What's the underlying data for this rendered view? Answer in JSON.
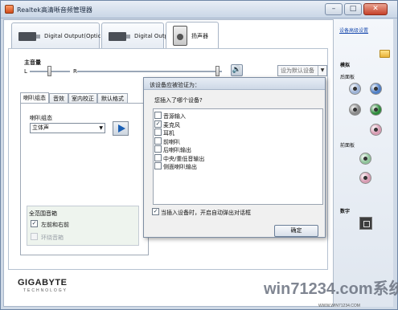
{
  "window": {
    "title": "Realtek高清晰音频管理器",
    "minimize": "–",
    "maximize": "□",
    "close": "✕"
  },
  "device_tabs": [
    {
      "label": "Digital Output(Optical)"
    },
    {
      "label": "Digital Output"
    },
    {
      "label": "扬声器",
      "active": true
    }
  ],
  "volume": {
    "label": "主音量",
    "left": "L",
    "right": "R",
    "balance": 0.5,
    "level": 0.97,
    "mute_icon": "speaker-icon",
    "default_device": "设为默认设备"
  },
  "sub_tabs": [
    {
      "label": "喇叭组态",
      "active": true
    },
    {
      "label": "音效"
    },
    {
      "label": "室内校正"
    },
    {
      "label": "默认格式"
    }
  ],
  "speaker_config": {
    "label": "喇叭组态",
    "selected": "立体声"
  },
  "full_range": {
    "title": "全范围音箱",
    "front": {
      "label": "左前和右前",
      "checked": true
    },
    "surround": {
      "label": "环绕音箱",
      "checked": false,
      "disabled": true
    }
  },
  "brand": {
    "name": "GIGABYTE",
    "tagline": "TECHNOLOGY"
  },
  "right_panel": {
    "advanced_link": "设备高级设置",
    "analog": "模拟",
    "back_panel": "后面板",
    "front_panel": "前面板",
    "digital": "数字",
    "jack_colors": [
      "#9db3d6",
      "#4f7fc6",
      "#8a8a8a",
      "#2e8b3c",
      "#d79bb2",
      "#8fc49a",
      "#d79bb2"
    ]
  },
  "dialog": {
    "title": "该设备应被验证为：",
    "question": "您插入了哪个设备?",
    "options": [
      {
        "label": "音源输入",
        "checked": false
      },
      {
        "label": "麦克风",
        "checked": true
      },
      {
        "label": "耳机",
        "checked": false
      },
      {
        "label": "前喇叭",
        "checked": false
      },
      {
        "label": "后喇叭输出",
        "checked": false
      },
      {
        "label": "中央/重低音输出",
        "checked": false
      },
      {
        "label": "侧面喇叭输出",
        "checked": false
      }
    ],
    "autopop": {
      "label": "当插入设备时，开启自动弹出对话框",
      "checked": true
    },
    "ok": "确定"
  },
  "watermark": {
    "text": "win71234.com",
    "suffix": "系统",
    "url": "WWW.WIN71234.COM"
  }
}
